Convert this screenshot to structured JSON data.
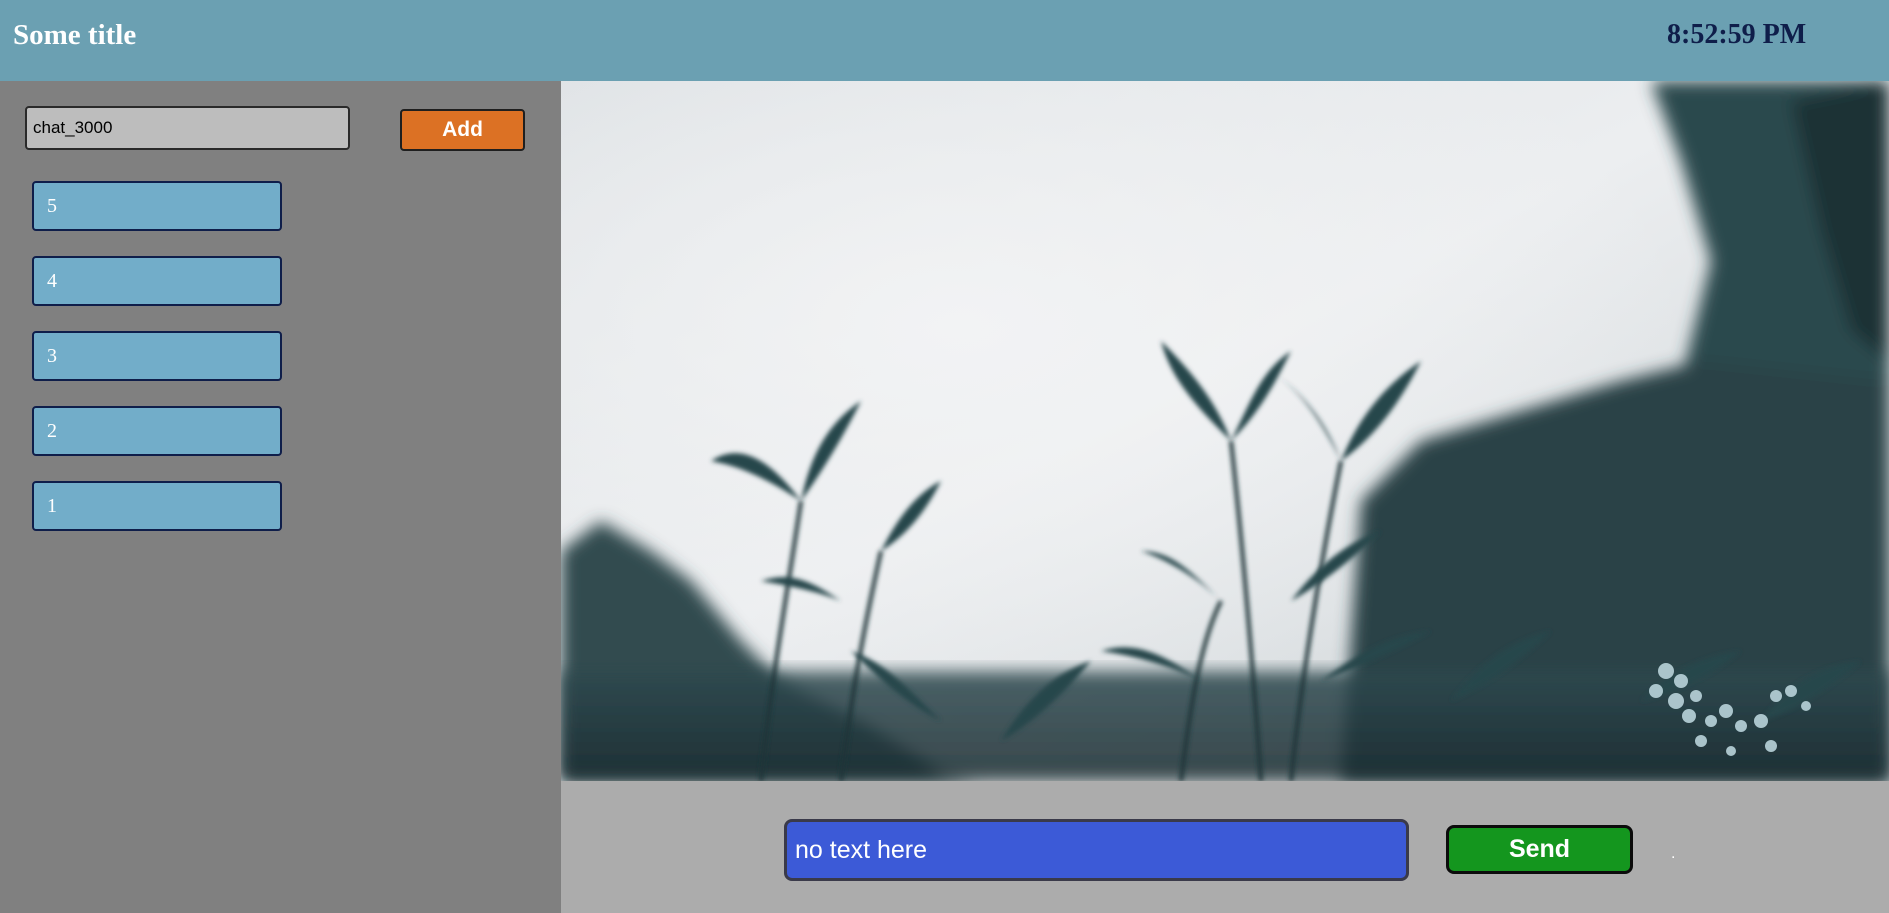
{
  "header": {
    "title": "Some title",
    "clock": "8:52:59 PM"
  },
  "sidebar": {
    "chat_input": {
      "value": "chat_3000"
    },
    "add_label": "Add",
    "chats": [
      {
        "label": "5"
      },
      {
        "label": "4"
      },
      {
        "label": "3"
      },
      {
        "label": "2"
      },
      {
        "label": "1"
      }
    ]
  },
  "main": {
    "image": {
      "icon": "plant-photo"
    },
    "composer": {
      "placeholder": "no text here",
      "send_label": "Send",
      "status_mark": "."
    }
  },
  "colors": {
    "header_bg": "#6ba0b2",
    "sidebar_bg": "#808080",
    "add_button": "#dc7124",
    "chat_item": "#72adc9",
    "message_input": "#3c5ad7",
    "send_button": "#14961e",
    "composer_bg": "#acacac"
  }
}
